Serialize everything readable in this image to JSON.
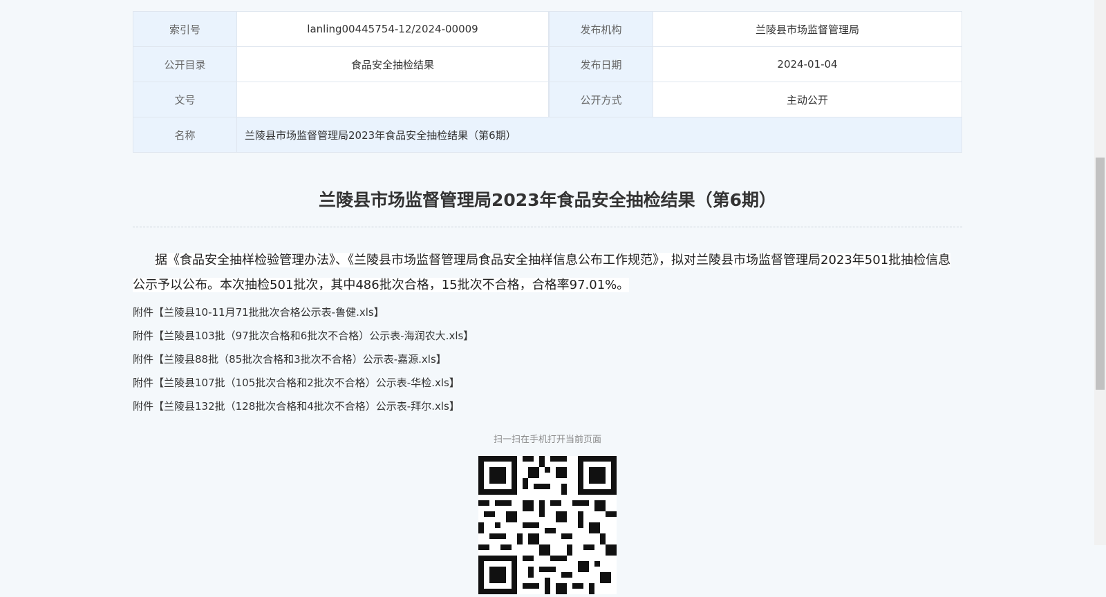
{
  "meta": {
    "index_label": "索引号",
    "index_value": "lanling00445754-12/2024-00009",
    "publisher_label": "发布机构",
    "publisher_value": "兰陵县市场监督管理局",
    "catalog_label": "公开目录",
    "catalog_value": "食品安全抽检结果",
    "date_label": "发布日期",
    "date_value": "2024-01-04",
    "docno_label": "文号",
    "docno_value": "",
    "mode_label": "公开方式",
    "mode_value": "主动公开",
    "name_label": "名称",
    "name_value": "兰陵县市场监督管理局2023年食品安全抽检结果（第6期）"
  },
  "article": {
    "title": "兰陵县市场监督管理局2023年食品安全抽检结果（第6期）",
    "body": "据《食品安全抽样检验管理办法》、《兰陵县市场监督管理局食品安全抽样信息公布工作规范》，拟对兰陵县市场监督管理局2023年501批抽检信息公示予以公布。本次抽检501批次，其中486批次合格，15批次不合格，合格率97.01%。",
    "attachments": [
      "附件【兰陵县10-11月71批批次合格公示表-鲁健.xls】",
      "附件【兰陵县103批（97批次合格和6批次不合格）公示表-海润农大.xls】",
      "附件【兰陵县88批（85批次合格和3批次不合格）公示表-嘉源.xls】",
      "附件【兰陵县107批（105批次合格和2批次不合格）公示表-华检.xls】",
      "附件【兰陵县132批（128批次合格和4批次不合格）公示表-拜尔.xls】"
    ]
  },
  "qr": {
    "caption": "扫一扫在手机打开当前页面"
  }
}
